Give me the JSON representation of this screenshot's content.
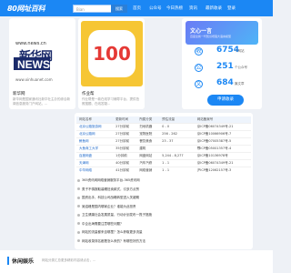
{
  "nav": {
    "logo": "80网址百科",
    "search_placeholder": "Bian",
    "search_btn": "搜索",
    "items": [
      "首页",
      "公众号",
      "今日热榜",
      "资讯",
      "最新收录",
      "登录"
    ]
  },
  "card1": {
    "site": "新华网",
    "url_text": "www.news.cn",
    "url_bottom": "www.xinhuanet.com",
    "title": "新华网",
    "desc": "新华网是国家通讯社新华社主办的综合新闻信息服务门户网站，..."
  },
  "card2": {
    "badge": "100",
    "title": "作业帮",
    "desc": "作业帮是一款在线学习辅导平台，提供拍照搜题、在线答疑..."
  },
  "promo": {
    "title": "文心一言",
    "sub": "百度全新一代知识增强大语言模型"
  },
  "stats": [
    {
      "icon": "收",
      "num": "6754",
      "label": "个网站"
    },
    {
      "icon": "公",
      "num": "251",
      "label": "个公众号"
    },
    {
      "icon": "文",
      "num": "684",
      "label": "篇文章"
    }
  ],
  "apply": "申请收录",
  "table": {
    "headers": [
      "网站名称",
      "更新时间",
      "所属分类",
      "预估流量",
      "网站备案号"
    ],
    "rows": [
      [
        "北京公路旅游网",
        "27分钟前",
        "扫地机器",
        "0 - 0",
        "京ICP备06074349号-21"
      ],
      [
        "北京公路网",
        "27分钟前",
        "宠物医院",
        "256 - 262",
        "京ICP备10066906号-7"
      ],
      [
        "鲸鱼网",
        "27分钟前",
        "餐饮美食",
        "23 - 37",
        "京ICP备07005387号-5"
      ],
      [
        "大鱼商工大学",
        "35分钟前",
        "建筑",
        "",
        "鄂ICP备05001357号-4"
      ],
      [
        "百度网盘",
        "1分钟前",
        "网盘网站",
        "5,244 - 8,277",
        "京ICP备10136978号"
      ],
      [
        "天津网",
        "40分钟前",
        "汽车汽修",
        "1 - 1",
        "京ICP备06074349号-21"
      ],
      [
        "中华网络",
        "41分钟前",
        "网络营销",
        "1 - 1",
        "沪ICP备12062157号-3"
      ]
    ]
  },
  "articles": [
    "365资讯网网络营销服务平台-365资讯网",
    "男子不慎报取装睡狂卖款式，引多方点赞",
    "国资出手，科技公司战略转型进入关键期",
    "吴绍峰是国内哪家企业？谁能为此担责",
    "卫生健康社会发展质量，行动计划发布一揽子措施",
    "中企出海需要注意哪些问题？",
    "网站的流量都来自哪里？怎么获取更多流量",
    "网站收录排名都是怎么来的？有哪些好的方法"
  ],
  "section": {
    "title": "休闲娱乐",
    "sub": "网站分类汇总更多精彩内容请点击，..."
  }
}
